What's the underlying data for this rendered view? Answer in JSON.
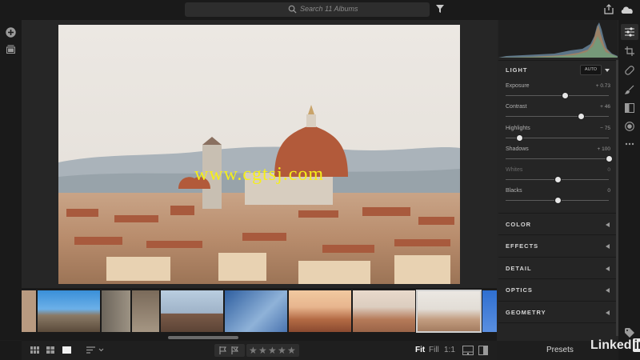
{
  "search": {
    "placeholder": "Search 11 Albums"
  },
  "light": {
    "title": "LIGHT",
    "auto_label": "AUTO",
    "sliders": [
      {
        "label": "Exposure",
        "value": "+ 0.73",
        "position": 0.57
      },
      {
        "label": "Contrast",
        "value": "+ 46",
        "position": 0.73
      },
      {
        "label": "Highlights",
        "value": "− 75",
        "position": 0.13
      },
      {
        "label": "Shadows",
        "value": "+ 100",
        "position": 1.0
      },
      {
        "label": "Whites",
        "value": "0",
        "position": 0.5
      },
      {
        "label": "Blacks",
        "value": "0",
        "position": 0.5
      }
    ]
  },
  "sections": [
    "COLOR",
    "EFFECTS",
    "DETAIL",
    "OPTICS",
    "GEOMETRY"
  ],
  "bottom": {
    "zoom_fit": "Fit",
    "zoom_fill": "Fill",
    "zoom_1to1": "1:1",
    "presets": "Presets"
  },
  "watermark": "www.cgtsj.com",
  "brand": {
    "name": "Linked",
    "suffix": "in"
  },
  "icons": [
    "search-icon",
    "filter-icon",
    "share-icon",
    "cloud-icon",
    "add-icon",
    "albums-icon",
    "edit-icon",
    "crop-icon",
    "healing-icon",
    "brush-icon",
    "linear-gradient-icon",
    "radial-gradient-icon",
    "more-icon",
    "tag-icon",
    "info-icon",
    "grid-view-icon",
    "square-grid-icon",
    "single-view-icon",
    "sort-icon",
    "flag-icon",
    "star-icon",
    "compare-icon",
    "split-view-icon"
  ],
  "colors": {
    "accent": "#e6e6e6",
    "panel": "#252525",
    "background": "#1e1e1e"
  }
}
